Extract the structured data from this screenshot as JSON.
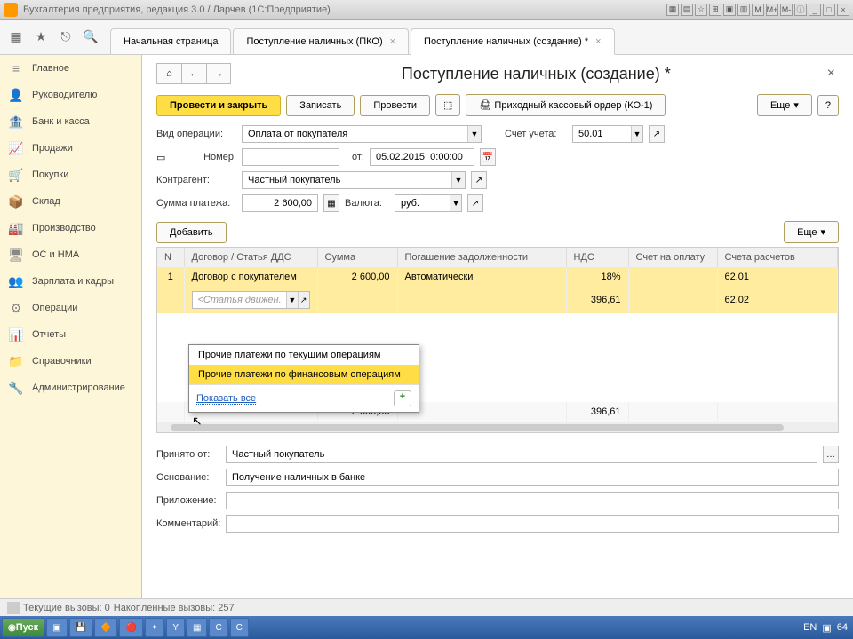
{
  "titlebar": {
    "title": "Бухгалтерия предприятия, редакция 3.0 / Ларчев  (1С:Предприятие)"
  },
  "toolbar_icons": [
    "apps",
    "star",
    "link",
    "search"
  ],
  "tabs": [
    {
      "label": "Начальная страница",
      "closable": false
    },
    {
      "label": "Поступление наличных (ПКО)",
      "closable": true
    },
    {
      "label": "Поступление наличных (создание) *",
      "closable": true,
      "active": true
    }
  ],
  "sidebar": {
    "items": [
      {
        "icon": "≡",
        "label": "Главное"
      },
      {
        "icon": "👤",
        "label": "Руководителю"
      },
      {
        "icon": "🏦",
        "label": "Банк и касса"
      },
      {
        "icon": "📈",
        "label": "Продажи"
      },
      {
        "icon": "🛒",
        "label": "Покупки"
      },
      {
        "icon": "📦",
        "label": "Склад"
      },
      {
        "icon": "🏭",
        "label": "Производство"
      },
      {
        "icon": "🖥",
        "label": "ОС и НМА"
      },
      {
        "icon": "👥",
        "label": "Зарплата и кадры"
      },
      {
        "icon": "⚙",
        "label": "Операции"
      },
      {
        "icon": "📊",
        "label": "Отчеты"
      },
      {
        "icon": "📁",
        "label": "Справочники"
      },
      {
        "icon": "🔧",
        "label": "Администрирование"
      }
    ]
  },
  "page": {
    "title": "Поступление наличных (создание) *",
    "actions": {
      "post_close": "Провести и закрыть",
      "save": "Записать",
      "post": "Провести",
      "print": "Приходный кассовый ордер (КО-1)",
      "more": "Еще",
      "help": "?"
    },
    "form": {
      "op_type_label": "Вид операции:",
      "op_type_value": "Оплата от покупателя",
      "account_label": "Счет учета:",
      "account_value": "50.01",
      "number_label": "Номер:",
      "number_value": "",
      "date_label": "от:",
      "date_value": "05.02.2015  0:00:00",
      "counterparty_label": "Контрагент:",
      "counterparty_value": "Частный покупатель",
      "sum_label": "Сумма платежа:",
      "sum_value": "2 600,00",
      "currency_label": "Валюта:",
      "currency_value": "руб."
    },
    "table_actions": {
      "add": "Добавить",
      "more": "Еще"
    },
    "table": {
      "columns": [
        "N",
        "Договор / Статья ДДС",
        "Сумма",
        "Погашение задолженности",
        "НДС",
        "Счет на оплату",
        "Счета расчетов"
      ],
      "row": {
        "n": "1",
        "contract": "Договор с покупателем",
        "sum": "2 600,00",
        "repay": "Автоматически",
        "vat": "18%",
        "invoice": "",
        "accounts1": "62.01"
      },
      "row2": {
        "dds_placeholder": "<Статья движен...",
        "vat_sum": "396,61",
        "accounts2": "62.02"
      },
      "totals": {
        "sum": "2 600,00",
        "vat": "396,61"
      }
    },
    "dropdown": {
      "item1": "Прочие платежи по текущим операциям",
      "item2": "Прочие платежи по финансовым операциям",
      "show_all": "Показать все",
      "plus": "+"
    },
    "lower": {
      "from_label": "Принято от:",
      "from_value": "Частный покупатель",
      "basis_label": "Основание:",
      "basis_value": "Получение наличных в банке",
      "attach_label": "Приложение:",
      "attach_value": "",
      "comment_label": "Комментарий:",
      "comment_value": ""
    }
  },
  "statusbar": {
    "text1": "Текущие вызовы: 0",
    "text2": "Накопленные вызовы: 257"
  },
  "taskbar": {
    "start": "Пуск",
    "lang": "EN",
    "time": "64"
  }
}
